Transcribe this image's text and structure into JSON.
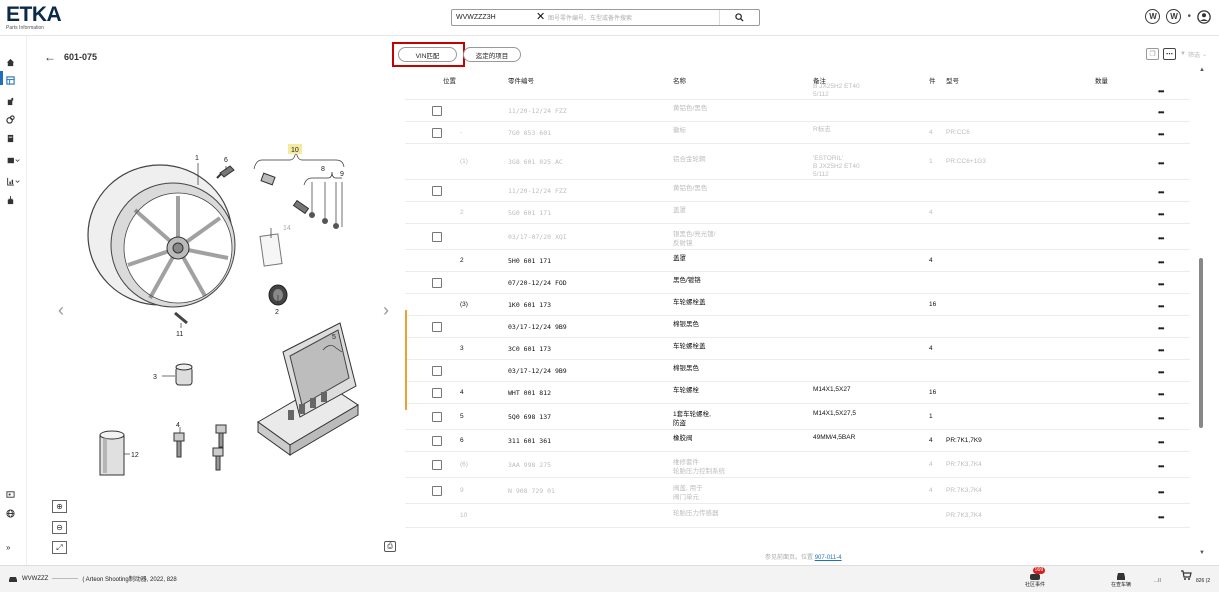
{
  "header": {
    "logo_main": "ETKA",
    "logo_sub": "Parts Information",
    "search_vin": "WVWZZZ3H",
    "search_placeholder": "图号零件编号、车型或备件搜索"
  },
  "sidebar": {
    "items": [
      "home-icon",
      "catalog-icon",
      "lubricant-icon",
      "service-icon",
      "document-icon",
      "service-plan-icon",
      "statistics-icon",
      "import-icon",
      "history-icon",
      "globe-icon",
      "expand-icon"
    ]
  },
  "illustration": {
    "back_label": "601-075",
    "callouts": [
      "1",
      "6",
      "10",
      "8",
      "9",
      "14",
      "2",
      "11",
      "5",
      "3",
      "4",
      "12"
    ]
  },
  "toolbar": {
    "vin_match": "VIN匹配",
    "selected_items": "迄定的项目",
    "filter_label": "筛选"
  },
  "table": {
    "columns": {
      "position": "位置",
      "part_no": "零件编号",
      "name": "名称",
      "note": "备注",
      "qty": "件",
      "model": "型号",
      "amount": "数量"
    },
    "rows": [
      {
        "style": "grey",
        "checkbox": false,
        "pos": "",
        "part_no": "",
        "name": "",
        "note": "B JX25H2 ET40\n5/112",
        "qty": "",
        "model": ""
      },
      {
        "style": "grey",
        "checkbox": true,
        "pos": "",
        "part_no": "11/20-12/24 FZZ",
        "name": "黄铝色/黑色",
        "note": "",
        "qty": "",
        "model": ""
      },
      {
        "style": "grey",
        "checkbox": true,
        "pos": "-",
        "part_no": "7G0 853 601",
        "name": "徽标",
        "note": "R标志",
        "qty": "4",
        "model": "PR:CC6"
      },
      {
        "style": "grey",
        "checkbox": false,
        "pos": "(1)",
        "part_no": "3G8 601 025 AC",
        "name": "铝合金轮辋",
        "note": "'ESTORIL'\nB JX25H2 ET40\n5/112",
        "qty": "1",
        "model": "PR:CC6+1G3"
      },
      {
        "style": "grey",
        "checkbox": true,
        "pos": "",
        "part_no": "11/20-12/24 FZZ",
        "name": "黄铝色/黑色",
        "note": "",
        "qty": "",
        "model": ""
      },
      {
        "style": "grey",
        "checkbox": false,
        "pos": "2",
        "part_no": "5G0 601 171",
        "name": "盖罩",
        "note": "",
        "qty": "4",
        "model": ""
      },
      {
        "style": "grey",
        "checkbox": true,
        "pos": "",
        "part_no": "03/17-07/20 XQI",
        "name": "银黑色/亮光镀/\n反射镜",
        "note": "",
        "qty": "",
        "model": ""
      },
      {
        "style": "dark",
        "checkbox": false,
        "pos": "2",
        "part_no": "5H0 601 171",
        "name": "盖罩",
        "note": "",
        "qty": "4",
        "model": ""
      },
      {
        "style": "dark",
        "checkbox": true,
        "pos": "",
        "part_no": "07/20-12/24 FOD",
        "name": "黑色/镀铬",
        "note": "",
        "qty": "",
        "model": ""
      },
      {
        "style": "dark",
        "checkbox": false,
        "pos": "(3)",
        "part_no": "1K0 601 173",
        "name": "车轮螺栓盖",
        "note": "",
        "qty": "16",
        "model": ""
      },
      {
        "style": "dark",
        "checkbox": true,
        "pos": "",
        "part_no": "03/17-12/24 9B9",
        "name": "棉银黑色",
        "note": "",
        "qty": "",
        "model": ""
      },
      {
        "style": "dark",
        "checkbox": false,
        "pos": "3",
        "part_no": "3C0 601 173",
        "name": "车轮螺栓盖",
        "note": "",
        "qty": "4",
        "model": ""
      },
      {
        "style": "dark",
        "checkbox": true,
        "pos": "",
        "part_no": "03/17-12/24 9B9",
        "name": "棉银黑色",
        "note": "",
        "qty": "",
        "model": ""
      },
      {
        "style": "dark",
        "checkbox": true,
        "pos": "4",
        "part_no": "WHT 001 812",
        "name": "车轮螺栓",
        "note": "M14X1,5X27",
        "qty": "16",
        "model": ""
      },
      {
        "style": "dark",
        "checkbox": true,
        "pos": "5",
        "part_no": "5Q0 698 137",
        "name": "1套车轮螺栓,\n防盗",
        "note": "M14X1,5X27,5",
        "qty": "1",
        "model": ""
      },
      {
        "style": "dark",
        "checkbox": true,
        "pos": "6",
        "part_no": "311 601 361",
        "name": "橡胶阀",
        "note": "49MM/4,5BAR",
        "qty": "4",
        "model": "PR:7K1,7K9"
      },
      {
        "style": "grey",
        "checkbox": true,
        "pos": "(6)",
        "part_no": "3AA 998 275",
        "name": "维修套件\n轮胎压力控制系统",
        "note": "",
        "qty": "4",
        "model": "PR:7K3,7K4"
      },
      {
        "style": "grey",
        "checkbox": true,
        "pos": "9",
        "part_no": "N  908 729 01",
        "name": "阀盖, 用于\n阀门单元",
        "note": "",
        "qty": "4",
        "model": "PR:7K3,7K4"
      },
      {
        "style": "grey",
        "checkbox": false,
        "pos": "10",
        "part_no": "",
        "name": "轮胎压力传感器",
        "note": "",
        "qty": "",
        "model": "PR:7K3,7K4"
      }
    ],
    "more_label": "•••"
  },
  "footer_note": {
    "text": "参见前面页。位置",
    "link": "907-011-4"
  },
  "bottombar": {
    "vehicle_vin": "WVWZZZ",
    "vehicle_desc": "( Arteon Shooting制动器, 2022, 828",
    "social_label": "社区事件",
    "social_badge": "999",
    "vehicle_btn_label": "在查车辆",
    "cart_text": "...II",
    "cart_count": "826 (2"
  },
  "colors": {
    "accent_blue": "#1f6fbf",
    "highlight_red": "#c40000",
    "orange_marker": "#f0a030"
  }
}
